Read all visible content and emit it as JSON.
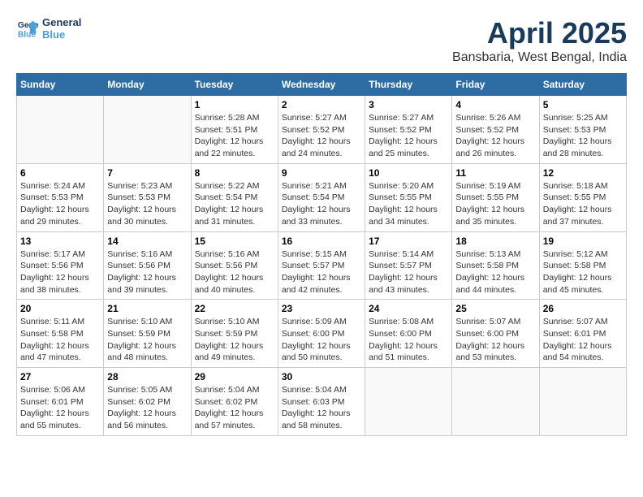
{
  "logo": {
    "line1": "General",
    "line2": "Blue"
  },
  "title": "April 2025",
  "subtitle": "Bansbaria, West Bengal, India",
  "weekdays": [
    "Sunday",
    "Monday",
    "Tuesday",
    "Wednesday",
    "Thursday",
    "Friday",
    "Saturday"
  ],
  "weeks": [
    [
      {
        "day": "",
        "sunrise": "",
        "sunset": "",
        "daylight": ""
      },
      {
        "day": "",
        "sunrise": "",
        "sunset": "",
        "daylight": ""
      },
      {
        "day": "1",
        "sunrise": "Sunrise: 5:28 AM",
        "sunset": "Sunset: 5:51 PM",
        "daylight": "Daylight: 12 hours and 22 minutes."
      },
      {
        "day": "2",
        "sunrise": "Sunrise: 5:27 AM",
        "sunset": "Sunset: 5:52 PM",
        "daylight": "Daylight: 12 hours and 24 minutes."
      },
      {
        "day": "3",
        "sunrise": "Sunrise: 5:27 AM",
        "sunset": "Sunset: 5:52 PM",
        "daylight": "Daylight: 12 hours and 25 minutes."
      },
      {
        "day": "4",
        "sunrise": "Sunrise: 5:26 AM",
        "sunset": "Sunset: 5:52 PM",
        "daylight": "Daylight: 12 hours and 26 minutes."
      },
      {
        "day": "5",
        "sunrise": "Sunrise: 5:25 AM",
        "sunset": "Sunset: 5:53 PM",
        "daylight": "Daylight: 12 hours and 28 minutes."
      }
    ],
    [
      {
        "day": "6",
        "sunrise": "Sunrise: 5:24 AM",
        "sunset": "Sunset: 5:53 PM",
        "daylight": "Daylight: 12 hours and 29 minutes."
      },
      {
        "day": "7",
        "sunrise": "Sunrise: 5:23 AM",
        "sunset": "Sunset: 5:53 PM",
        "daylight": "Daylight: 12 hours and 30 minutes."
      },
      {
        "day": "8",
        "sunrise": "Sunrise: 5:22 AM",
        "sunset": "Sunset: 5:54 PM",
        "daylight": "Daylight: 12 hours and 31 minutes."
      },
      {
        "day": "9",
        "sunrise": "Sunrise: 5:21 AM",
        "sunset": "Sunset: 5:54 PM",
        "daylight": "Daylight: 12 hours and 33 minutes."
      },
      {
        "day": "10",
        "sunrise": "Sunrise: 5:20 AM",
        "sunset": "Sunset: 5:55 PM",
        "daylight": "Daylight: 12 hours and 34 minutes."
      },
      {
        "day": "11",
        "sunrise": "Sunrise: 5:19 AM",
        "sunset": "Sunset: 5:55 PM",
        "daylight": "Daylight: 12 hours and 35 minutes."
      },
      {
        "day": "12",
        "sunrise": "Sunrise: 5:18 AM",
        "sunset": "Sunset: 5:55 PM",
        "daylight": "Daylight: 12 hours and 37 minutes."
      }
    ],
    [
      {
        "day": "13",
        "sunrise": "Sunrise: 5:17 AM",
        "sunset": "Sunset: 5:56 PM",
        "daylight": "Daylight: 12 hours and 38 minutes."
      },
      {
        "day": "14",
        "sunrise": "Sunrise: 5:16 AM",
        "sunset": "Sunset: 5:56 PM",
        "daylight": "Daylight: 12 hours and 39 minutes."
      },
      {
        "day": "15",
        "sunrise": "Sunrise: 5:16 AM",
        "sunset": "Sunset: 5:56 PM",
        "daylight": "Daylight: 12 hours and 40 minutes."
      },
      {
        "day": "16",
        "sunrise": "Sunrise: 5:15 AM",
        "sunset": "Sunset: 5:57 PM",
        "daylight": "Daylight: 12 hours and 42 minutes."
      },
      {
        "day": "17",
        "sunrise": "Sunrise: 5:14 AM",
        "sunset": "Sunset: 5:57 PM",
        "daylight": "Daylight: 12 hours and 43 minutes."
      },
      {
        "day": "18",
        "sunrise": "Sunrise: 5:13 AM",
        "sunset": "Sunset: 5:58 PM",
        "daylight": "Daylight: 12 hours and 44 minutes."
      },
      {
        "day": "19",
        "sunrise": "Sunrise: 5:12 AM",
        "sunset": "Sunset: 5:58 PM",
        "daylight": "Daylight: 12 hours and 45 minutes."
      }
    ],
    [
      {
        "day": "20",
        "sunrise": "Sunrise: 5:11 AM",
        "sunset": "Sunset: 5:58 PM",
        "daylight": "Daylight: 12 hours and 47 minutes."
      },
      {
        "day": "21",
        "sunrise": "Sunrise: 5:10 AM",
        "sunset": "Sunset: 5:59 PM",
        "daylight": "Daylight: 12 hours and 48 minutes."
      },
      {
        "day": "22",
        "sunrise": "Sunrise: 5:10 AM",
        "sunset": "Sunset: 5:59 PM",
        "daylight": "Daylight: 12 hours and 49 minutes."
      },
      {
        "day": "23",
        "sunrise": "Sunrise: 5:09 AM",
        "sunset": "Sunset: 6:00 PM",
        "daylight": "Daylight: 12 hours and 50 minutes."
      },
      {
        "day": "24",
        "sunrise": "Sunrise: 5:08 AM",
        "sunset": "Sunset: 6:00 PM",
        "daylight": "Daylight: 12 hours and 51 minutes."
      },
      {
        "day": "25",
        "sunrise": "Sunrise: 5:07 AM",
        "sunset": "Sunset: 6:00 PM",
        "daylight": "Daylight: 12 hours and 53 minutes."
      },
      {
        "day": "26",
        "sunrise": "Sunrise: 5:07 AM",
        "sunset": "Sunset: 6:01 PM",
        "daylight": "Daylight: 12 hours and 54 minutes."
      }
    ],
    [
      {
        "day": "27",
        "sunrise": "Sunrise: 5:06 AM",
        "sunset": "Sunset: 6:01 PM",
        "daylight": "Daylight: 12 hours and 55 minutes."
      },
      {
        "day": "28",
        "sunrise": "Sunrise: 5:05 AM",
        "sunset": "Sunset: 6:02 PM",
        "daylight": "Daylight: 12 hours and 56 minutes."
      },
      {
        "day": "29",
        "sunrise": "Sunrise: 5:04 AM",
        "sunset": "Sunset: 6:02 PM",
        "daylight": "Daylight: 12 hours and 57 minutes."
      },
      {
        "day": "30",
        "sunrise": "Sunrise: 5:04 AM",
        "sunset": "Sunset: 6:03 PM",
        "daylight": "Daylight: 12 hours and 58 minutes."
      },
      {
        "day": "",
        "sunrise": "",
        "sunset": "",
        "daylight": ""
      },
      {
        "day": "",
        "sunrise": "",
        "sunset": "",
        "daylight": ""
      },
      {
        "day": "",
        "sunrise": "",
        "sunset": "",
        "daylight": ""
      }
    ]
  ]
}
